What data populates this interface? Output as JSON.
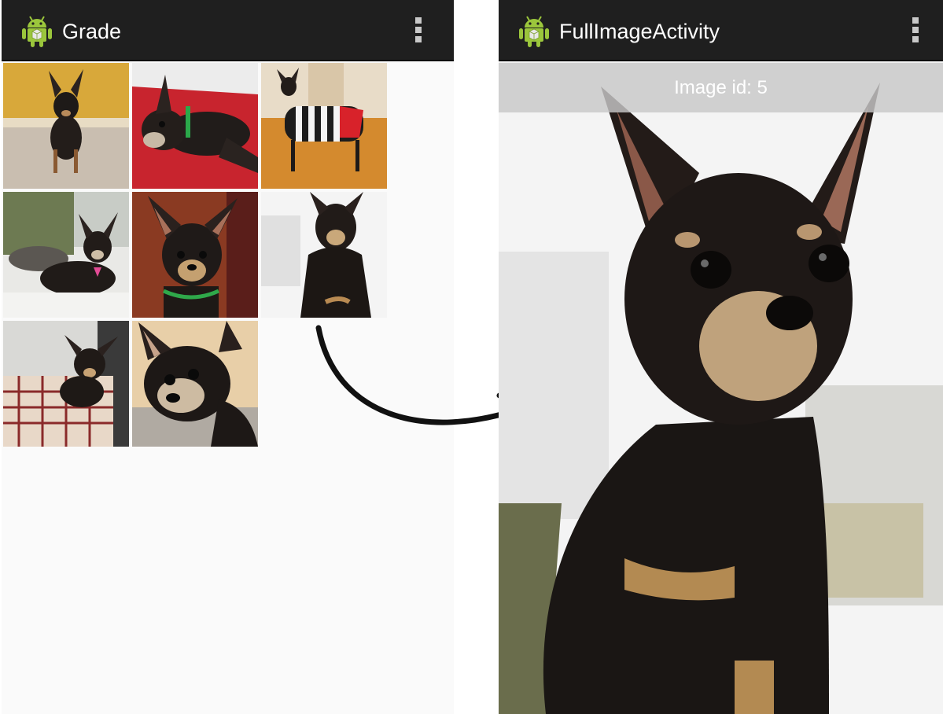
{
  "grid_screen": {
    "title": "Grade",
    "app_icon": "android-icon",
    "menu_icon": "overflow-menu-icon",
    "thumbnails": [
      {
        "alt": "chihuahua standing on carpet"
      },
      {
        "alt": "chihuahua lying on red cushion"
      },
      {
        "alt": "chihuahua in striped sweater"
      },
      {
        "alt": "chihuahua lying by window with cat"
      },
      {
        "alt": "chihuahua portrait with collar"
      },
      {
        "alt": "chihuahua sitting"
      },
      {
        "alt": "chihuahua in plaid bag"
      },
      {
        "alt": "chihuahua close-up face"
      }
    ]
  },
  "full_screen": {
    "title": "FullImageActivity",
    "app_icon": "android-icon",
    "menu_icon": "overflow-menu-icon",
    "image_id_label": "Image id: 5"
  },
  "transition_arrow": "curved-arrow-icon",
  "colors": {
    "actionbar": "#1f1f1f",
    "android_green": "#9bc63c"
  }
}
